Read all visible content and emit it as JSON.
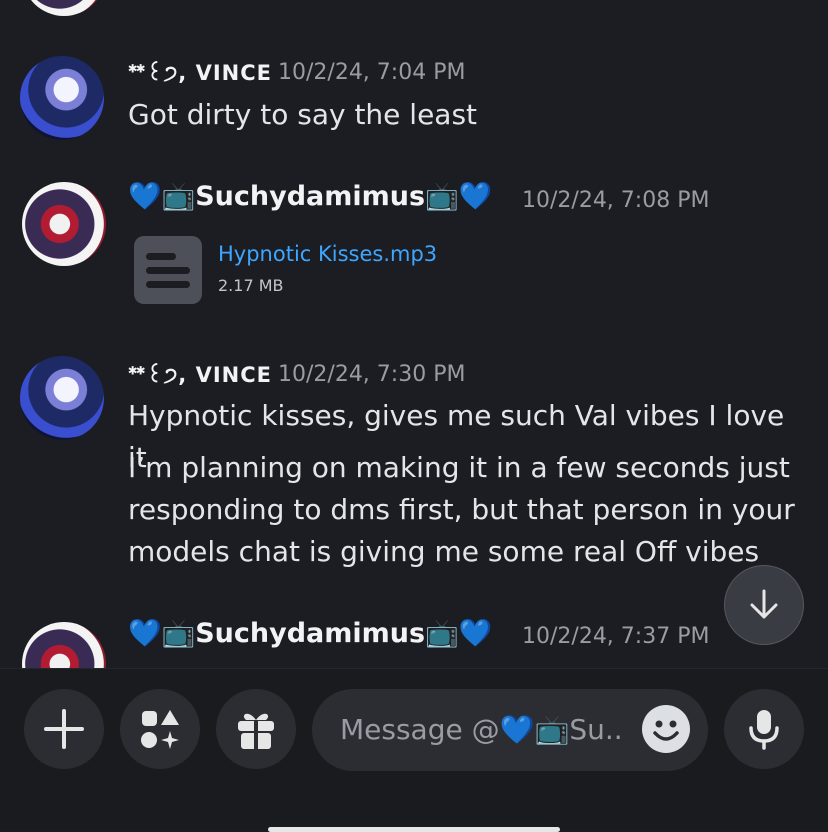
{
  "messages": [
    {
      "author": "ᕯ꒰੭, VINCE",
      "timestamp": "10/2/24, 7:04 PM",
      "lines": [
        "Got dirty to say the least"
      ]
    },
    {
      "author": "💙📺Suchydamimus📺💙",
      "timestamp": "10/2/24, 7:08 PM",
      "attachment": {
        "name": "Hypnotic Kisses.mp3",
        "size": "2.17 MB"
      }
    },
    {
      "author": "ᕯ꒰੭, VINCE",
      "timestamp": "10/2/24, 7:30 PM",
      "lines": [
        "Hypnotic kisses, gives me such Val vibes I love it",
        "I’m planning on making it in a few seconds just responding to dms first, but that person in your models chat is giving me some real Off vibes"
      ]
    },
    {
      "author": "💙📺Suchydamimus📺💙",
      "timestamp": "10/2/24, 7:37 PM"
    }
  ],
  "composer": {
    "placeholder": "Message @💙📺Su.."
  },
  "icons": [
    "plus-icon",
    "apps-icon",
    "gift-icon",
    "emoji-icon",
    "microphone-icon",
    "arrow-down-icon",
    "file-icon"
  ],
  "colors": {
    "background": "#1c1d22",
    "link": "#3ea6ff",
    "timestamp": "#9a9ca3"
  }
}
